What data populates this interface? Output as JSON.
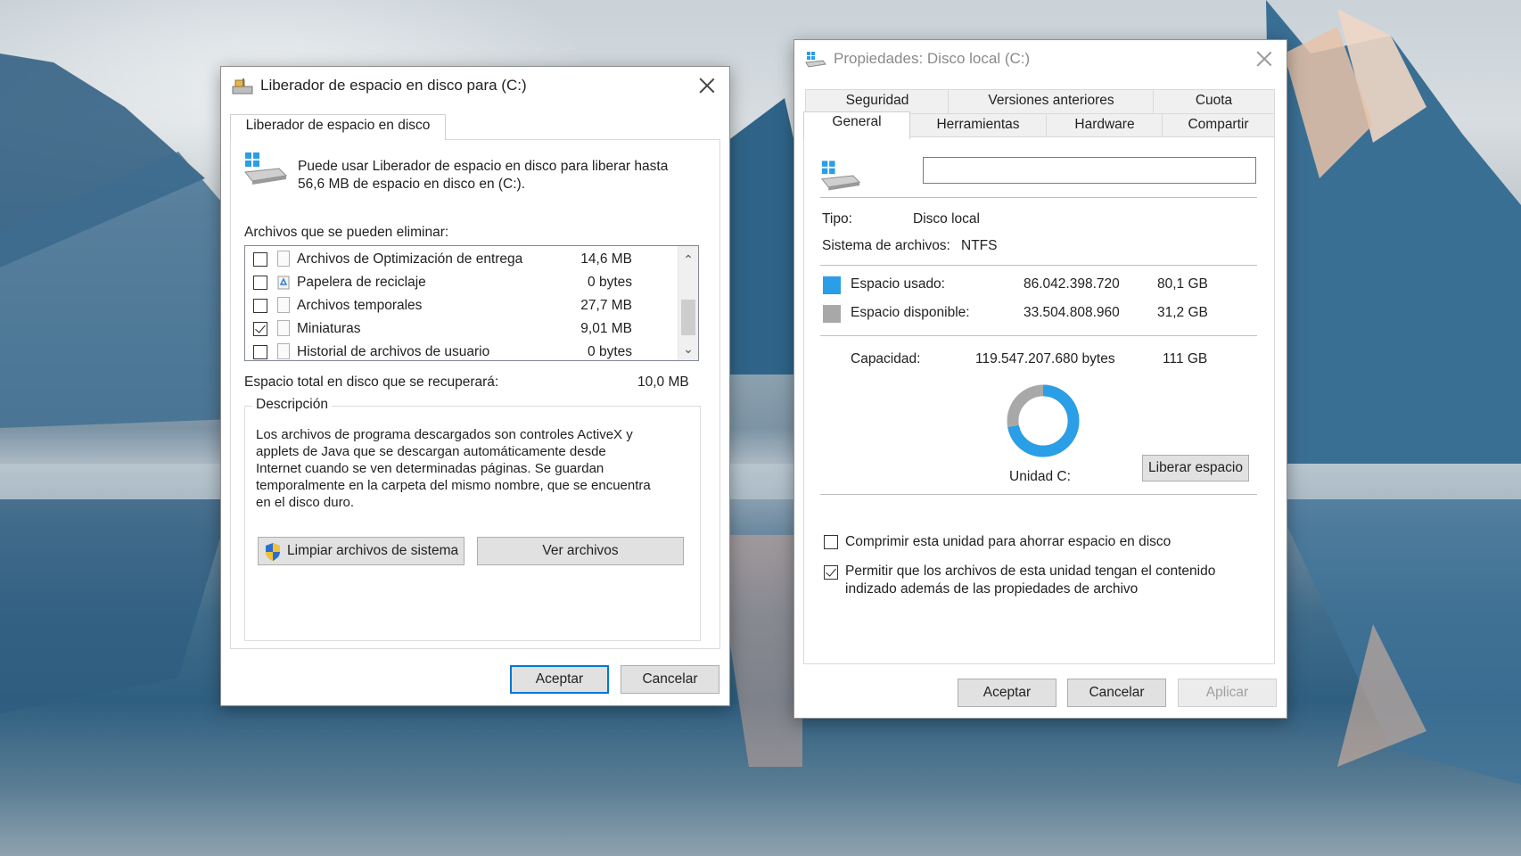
{
  "cleanup_window": {
    "title": "Liberador de espacio en disco para  (C:)",
    "tab_label": "Liberador de espacio en disco",
    "intro_line1": "Puede usar Liberador de espacio en disco para liberar hasta",
    "intro_line2": "56,6 MB de espacio en disco en  (C:).",
    "files_label": "Archivos que se pueden eliminar:",
    "files": [
      {
        "name": "Archivos de Optimización de entrega",
        "size": "14,6 MB",
        "checked": false
      },
      {
        "name": "Papelera de reciclaje",
        "size": "0 bytes",
        "checked": false
      },
      {
        "name": "Archivos temporales",
        "size": "27,7 MB",
        "checked": false
      },
      {
        "name": "Miniaturas",
        "size": "9,01 MB",
        "checked": true
      },
      {
        "name": "Historial de archivos de usuario",
        "size": "0 bytes",
        "checked": false
      }
    ],
    "total_label": "Espacio total en disco que se recuperará:",
    "total_value": "10,0 MB",
    "description_title": "Descripción",
    "description_lines": [
      "Los archivos de programa descargados son controles ActiveX y",
      "applets de Java que se descargan automáticamente desde",
      "Internet cuando se ven determinadas páginas. Se guardan",
      "temporalmente en la carpeta del mismo nombre, que se encuentra",
      "en el disco duro."
    ],
    "clean_system_button": "Limpiar archivos de sistema",
    "view_files_button": "Ver archivos",
    "ok_button": "Aceptar",
    "cancel_button": "Cancelar"
  },
  "properties_window": {
    "title": "Propiedades: Disco local (C:)",
    "tabs_row1": [
      "Seguridad",
      "Versiones anteriores",
      "Cuota"
    ],
    "tabs_row2": [
      "General",
      "Herramientas",
      "Hardware",
      "Compartir"
    ],
    "active_tab": "General",
    "name_input_value": "",
    "type_label": "Tipo:",
    "type_value": "Disco local",
    "fs_label": "Sistema de archivos:",
    "fs_value": "NTFS",
    "used_label": "Espacio usado:",
    "used_bytes": "86.042.398.720",
    "used_gb": "80,1 GB",
    "free_label": "Espacio disponible:",
    "free_bytes": "33.504.808.960",
    "free_gb": "31,2 GB",
    "capacity_label": "Capacidad:",
    "capacity_bytes": "119.547.207.680 bytes",
    "capacity_gb": "111 GB",
    "drive_label": "Unidad C:",
    "free_space_button": "Liberar espacio",
    "compress_label": "Comprimir esta unidad para ahorrar espacio en disco",
    "compress_checked": false,
    "index_label_line1": "Permitir que los archivos de esta unidad tengan el contenido",
    "index_label_line2": "indizado además de las propiedades de archivo",
    "index_checked": true,
    "ok_button": "Aceptar",
    "cancel_button": "Cancelar",
    "apply_button": "Aplicar",
    "used_fraction": 0.72,
    "colors": {
      "used": "#2a9ee6",
      "free": "#a8a8a8"
    }
  }
}
